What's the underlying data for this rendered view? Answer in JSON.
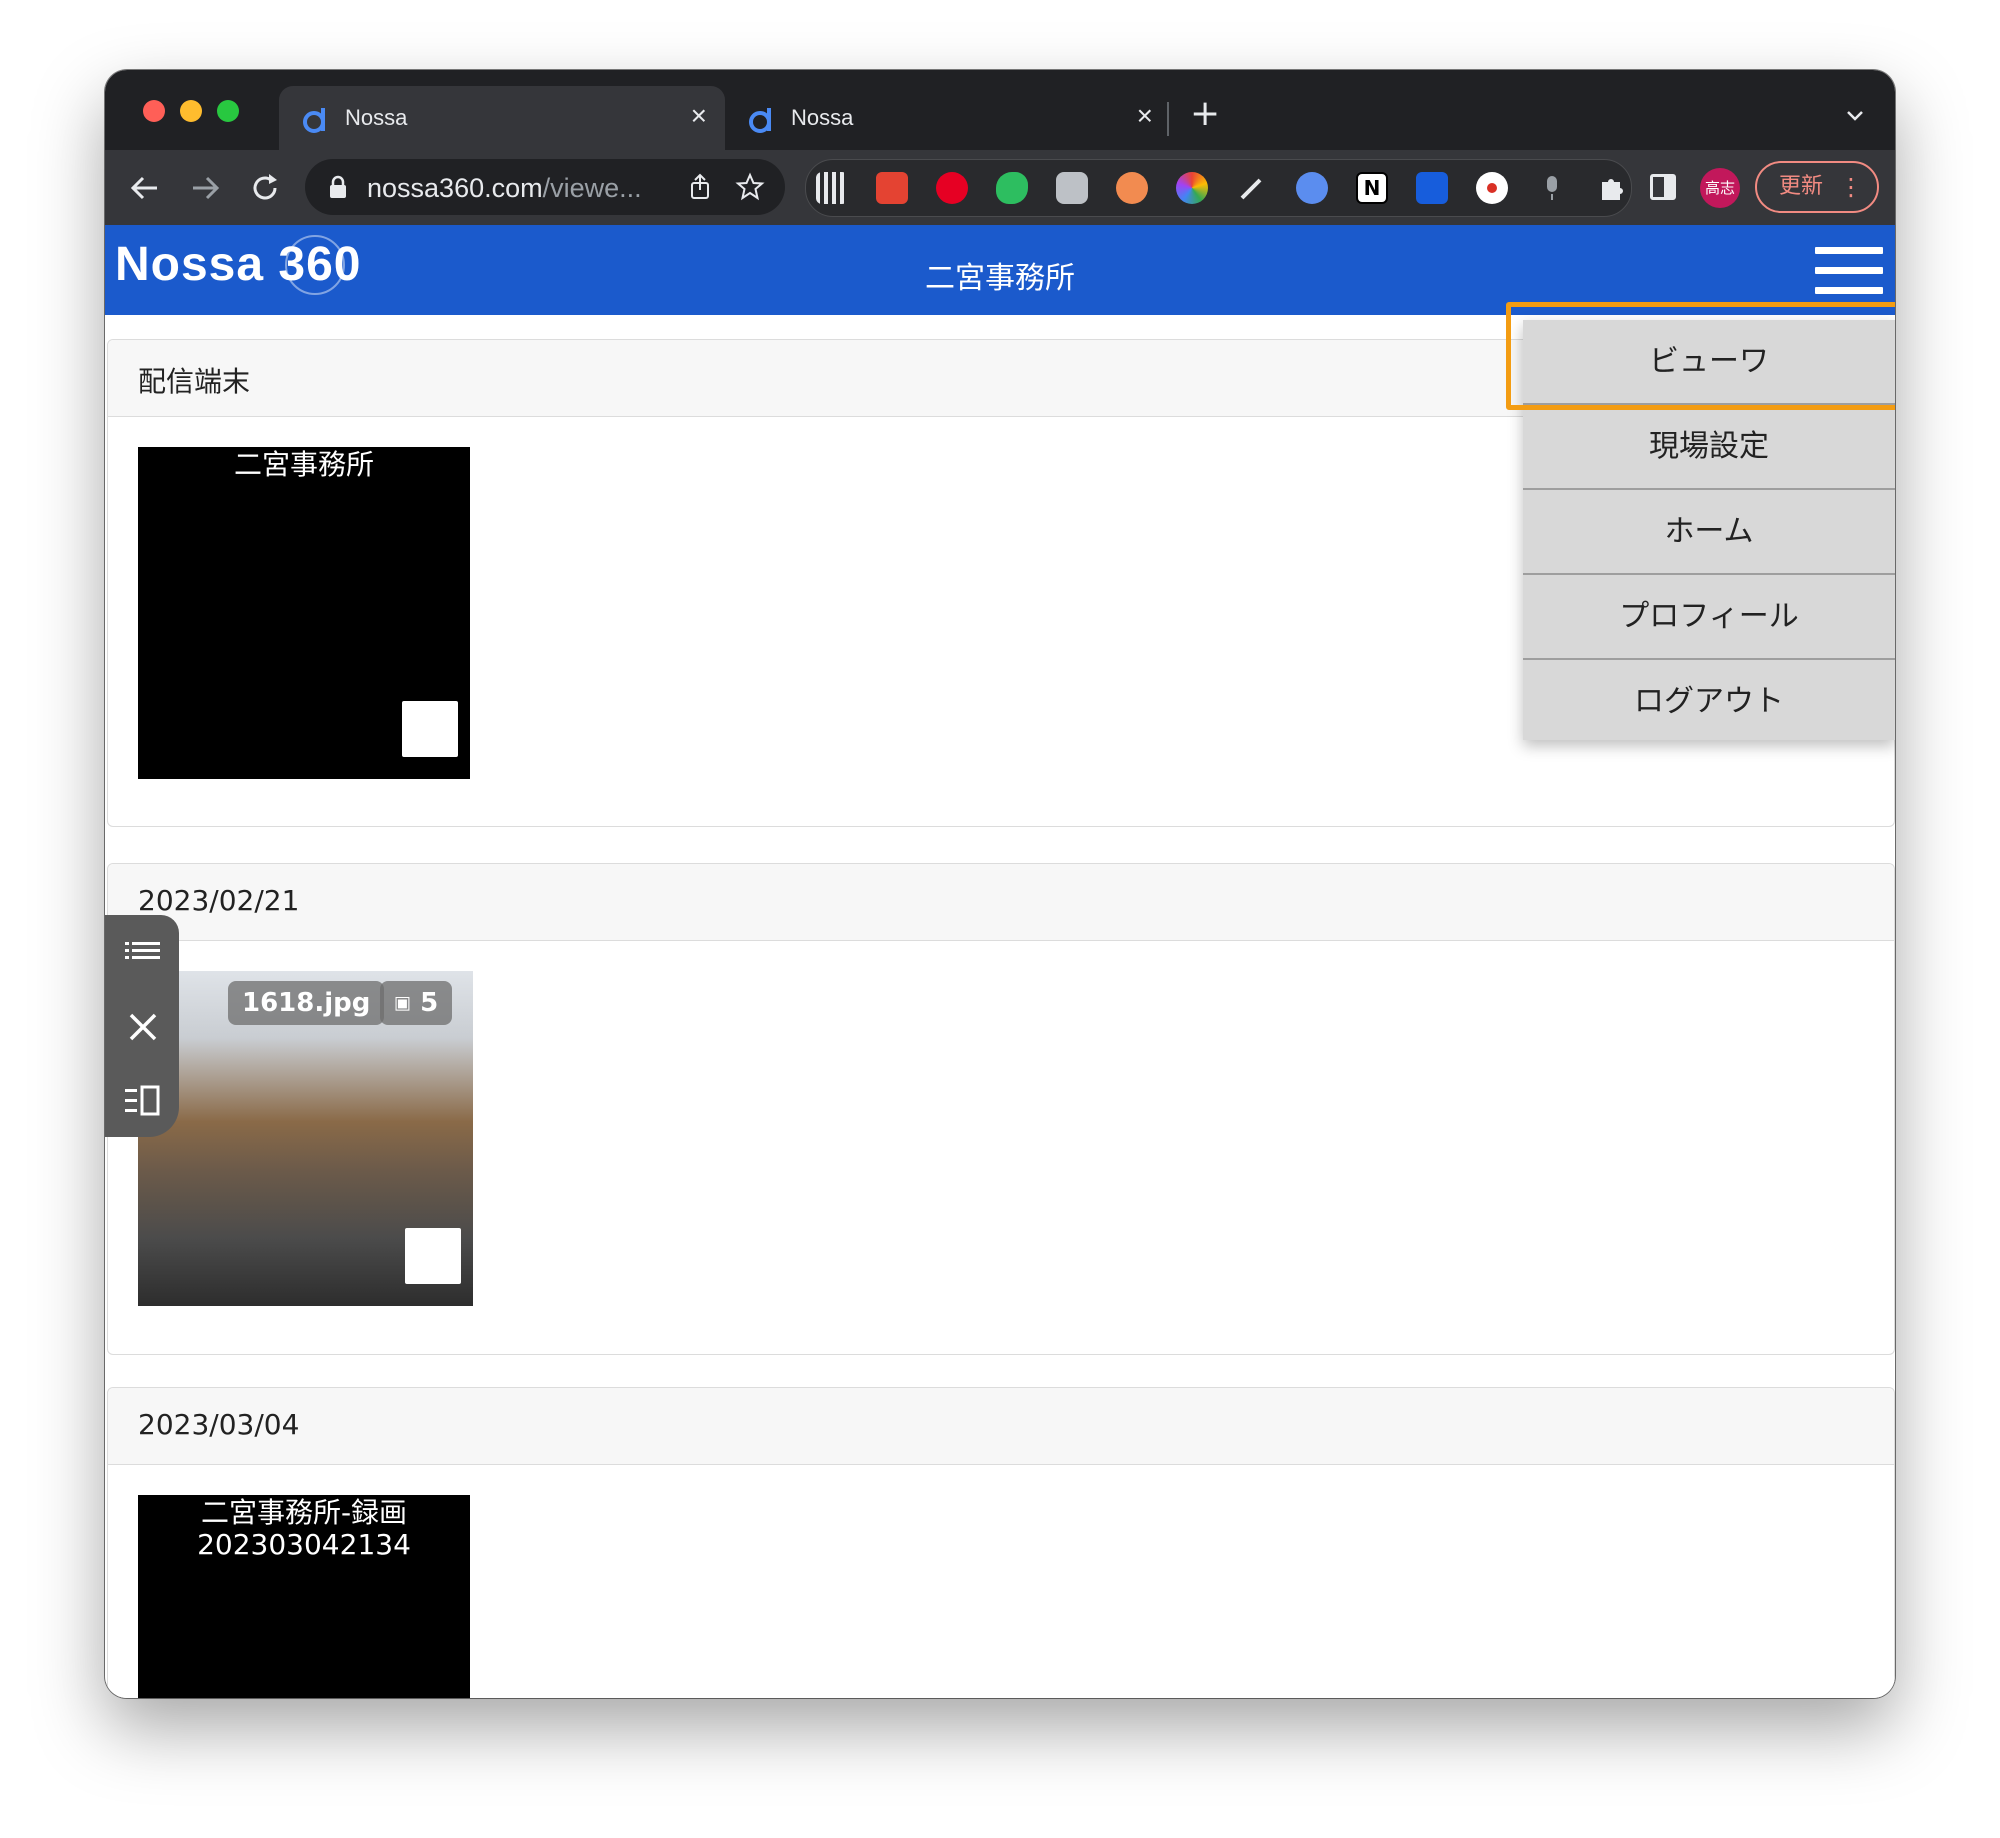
{
  "browser": {
    "tabs": [
      {
        "title": "Nossa",
        "active": true
      },
      {
        "title": "Nossa",
        "active": false
      }
    ],
    "url_host": "nossa360.com",
    "url_path": "/viewe...",
    "profile_initials": "高志",
    "update_label": "更新"
  },
  "app": {
    "logo": "Nossa 360",
    "page_title": "二宮事務所",
    "brand_color": "#1b5acc"
  },
  "menu": {
    "items": [
      "ビューワ",
      "現場設定",
      "ホーム",
      "プロフィール",
      "ログアウト"
    ],
    "highlighted_index": 0,
    "highlight_color": "#f39c12"
  },
  "sections": [
    {
      "header": "配信端末",
      "thumb": {
        "label": "二宮事務所",
        "type": "device"
      }
    },
    {
      "header": "2023/02/21",
      "thumb": {
        "filename": "1618.jpg",
        "image_count": "5",
        "type": "photo"
      }
    },
    {
      "header": "2023/03/04",
      "thumb": {
        "label_line1": "二宮事務所-録画",
        "label_line2": "202303042134",
        "type": "recording"
      }
    }
  ],
  "icons": {
    "side_tools": [
      "list-icon",
      "close-icon",
      "panel-icon"
    ]
  }
}
